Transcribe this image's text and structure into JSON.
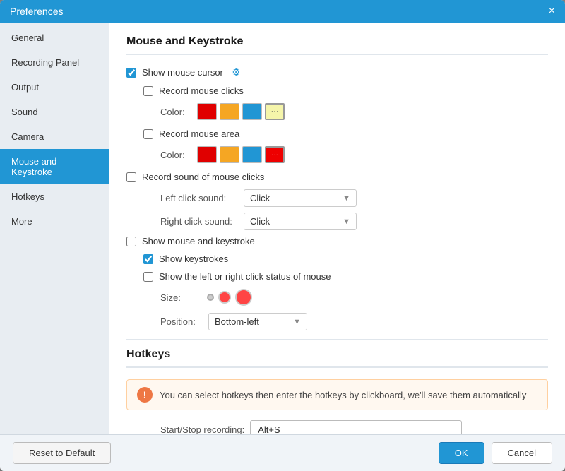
{
  "dialog": {
    "title": "Preferences",
    "close_icon": "×"
  },
  "sidebar": {
    "items": [
      {
        "id": "general",
        "label": "General",
        "active": false
      },
      {
        "id": "recording-panel",
        "label": "Recording Panel",
        "active": false
      },
      {
        "id": "output",
        "label": "Output",
        "active": false
      },
      {
        "id": "sound",
        "label": "Sound",
        "active": false
      },
      {
        "id": "camera",
        "label": "Camera",
        "active": false
      },
      {
        "id": "mouse-keystroke",
        "label": "Mouse and Keystroke",
        "active": true
      },
      {
        "id": "hotkeys",
        "label": "Hotkeys",
        "active": false
      },
      {
        "id": "more",
        "label": "More",
        "active": false
      }
    ]
  },
  "main": {
    "mouse_section": {
      "title": "Mouse and Keystroke",
      "show_cursor_label": "Show mouse cursor",
      "record_clicks_label": "Record mouse clicks",
      "color_label": "Color:",
      "record_area_label": "Record mouse area",
      "record_sound_label": "Record sound of mouse clicks",
      "left_click_label": "Left click sound:",
      "left_click_value": "Click",
      "right_click_label": "Right click sound:",
      "right_click_value": "Click",
      "show_keystroke_label": "Show mouse and keystroke",
      "show_keystrokes_label": "Show keystrokes",
      "show_leftright_label": "Show the left or right click status of mouse",
      "size_label": "Size:",
      "position_label": "Position:",
      "position_value": "Bottom-left"
    },
    "hotkeys_section": {
      "title": "Hotkeys",
      "info_text": "You can select hotkeys then enter the hotkeys by clickboard, we'll save them automatically",
      "start_stop_label": "Start/Stop recording:",
      "start_stop_value": "Alt+S"
    }
  },
  "footer": {
    "reset_label": "Reset to Default",
    "ok_label": "OK",
    "cancel_label": "Cancel"
  },
  "colors": {
    "active_sidebar": "#2196d4",
    "button_primary": "#2196d4"
  }
}
